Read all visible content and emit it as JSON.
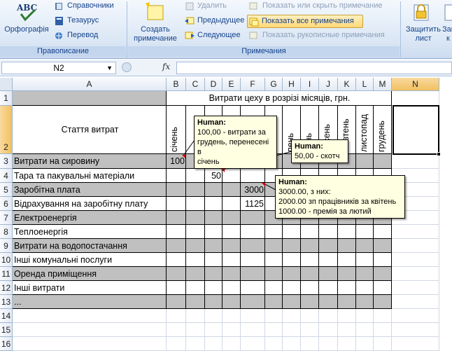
{
  "ribbon": {
    "proofing": {
      "spelling_label": "Орфографія",
      "research_label": "Справочники",
      "thesaurus_label": "Тезаурус",
      "translate_label": "Перевод",
      "group_label": "Правописание"
    },
    "comments": {
      "new_comment_line1": "Создать",
      "new_comment_line2": "примечание",
      "delete_label": "Удалить",
      "previous_label": "Предыдущее",
      "next_label": "Следующее",
      "show_hide_label": "Показать или скрыть примечание",
      "show_all_label": "Показать все примечания",
      "show_ink_label": "Показать рукописные примечания",
      "group_label": "Примечания"
    },
    "protect": {
      "protect_sheet_line1": "Защитить",
      "protect_sheet_line2": "лист",
      "protect_book_line1": "Защит",
      "protect_book_line2": "к"
    }
  },
  "formula_bar": {
    "name_box": "N2",
    "fx": "fx"
  },
  "columns": [
    "A",
    "B",
    "C",
    "D",
    "E",
    "F",
    "G",
    "H",
    "I",
    "J",
    "K",
    "L",
    "M",
    "N"
  ],
  "rows": [
    "1",
    "2",
    "3",
    "4",
    "5",
    "6",
    "7",
    "8",
    "9",
    "10",
    "11",
    "12",
    "13",
    "14",
    "15",
    "16"
  ],
  "sheet": {
    "title": "Витрати цеху в розрізі місяців, грн.",
    "item_header": "Стаття витрат",
    "months_visible": [
      "січень",
      "",
      "",
      "",
      "",
      "",
      "пень",
      "пень",
      "весень",
      "жовтень",
      "листопад",
      "грудень"
    ],
    "items": [
      "Витрати на сировину",
      "Тара та пакувальні матеріали",
      "Заробітна плата",
      "Відрахування на заробітну плату",
      "Електроенергія",
      "Теплоенергія",
      "Витрати на водопостачання",
      "Інші комунальні послуги",
      "Оренда приміщення",
      "Інші витрати",
      "..."
    ],
    "values": {
      "B3": "100",
      "D4": "50",
      "F5": "3000",
      "F6": "1125"
    }
  },
  "comments": [
    {
      "author": "Human:",
      "lines": [
        "100,00 - витрати за",
        "грудень, перенесені в",
        "січень"
      ]
    },
    {
      "author": "Human:",
      "lines": [
        "50,00 - скотч"
      ]
    },
    {
      "author": "Human:",
      "lines": [
        "3000.00, з них:",
        "2000.00 зп працівників за квітень",
        "1000.00 - премія за лютий"
      ]
    }
  ]
}
